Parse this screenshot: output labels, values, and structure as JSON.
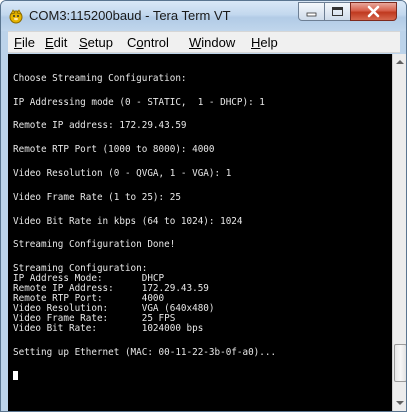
{
  "window": {
    "title": "COM3:115200baud - Tera Term VT",
    "controls": [
      "minimize",
      "maximize",
      "close"
    ]
  },
  "menu": [
    {
      "mnemonic": "F",
      "rest": "ile"
    },
    {
      "mnemonic": "E",
      "rest": "dit"
    },
    {
      "mnemonic": "S",
      "rest": "etup"
    },
    {
      "pre": "C",
      "mnemonic": "o",
      "rest": "ntrol"
    },
    {
      "mnemonic": "W",
      "rest": "indow"
    },
    {
      "mnemonic": "H",
      "rest": "elp"
    }
  ],
  "terminal": {
    "lines": [
      "Choose Streaming Configuration:",
      "IP Addressing mode (0 - STATIC,  1 - DHCP): 1",
      "Remote IP address: 172.29.43.59",
      "Remote RTP Port (1000 to 8000): 4000",
      "Video Resolution (0 - QVGA, 1 - VGA): 1",
      "Video Frame Rate (1 to 25): 25",
      "Video Bit Rate in kbps (64 to 1024): 1024",
      "Streaming Configuration Done!",
      "Streaming Configuration:",
      "IP Address Mode:       DHCP",
      "Remote IP Address:     172.29.43.59",
      "Remote RTP Port:       4000",
      "Video Resolution:      VGA (640x480)",
      "Video Frame Rate:      25 FPS",
      "Video Bit Rate:        1024000 bps",
      "Setting up Ethernet (MAC: 00-11-22-3b-0f-a0)..."
    ]
  },
  "colors": {
    "terminal_bg": "#000000",
    "terminal_fg": "#e8e8e8",
    "titlebar": "#c3d8ee",
    "close_button": "#c0391f"
  }
}
